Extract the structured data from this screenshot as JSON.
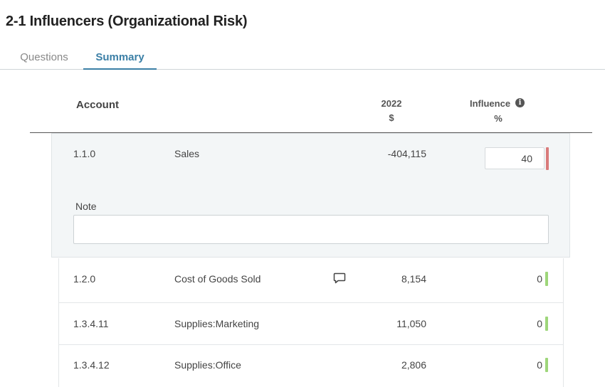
{
  "page": {
    "title": "2-1 Influencers (Organizational Risk)"
  },
  "tabs": [
    {
      "label": "Questions",
      "active": false
    },
    {
      "label": "Summary",
      "active": true
    }
  ],
  "table": {
    "headers": {
      "account": "Account",
      "year": "2022",
      "currency": "$",
      "influence": "Influence",
      "influence_unit": "%"
    },
    "expanded_row": {
      "account_number": "1.1.0",
      "account_name": "Sales",
      "amount": "-404,115",
      "influence": "40",
      "indicator_color": "#d97b7b",
      "note_label": "Note",
      "note_value": ""
    },
    "rows": [
      {
        "account_number": "1.2.0",
        "account_name": "Cost of Goods Sold",
        "amount": "8,154",
        "influence": "0",
        "has_comment": true,
        "indicator_color": "#9ed67a"
      },
      {
        "account_number": "1.3.4.11",
        "account_name": "Supplies:Marketing",
        "amount": "11,050",
        "influence": "0",
        "has_comment": false,
        "indicator_color": "#9ed67a"
      },
      {
        "account_number": "1.3.4.12",
        "account_name": "Supplies:Office",
        "amount": "2,806",
        "influence": "0",
        "has_comment": false,
        "indicator_color": "#9ed67a"
      }
    ]
  },
  "colors": {
    "accent": "#3b7fa6",
    "high_risk": "#d97b7b",
    "low_risk": "#9ed67a"
  },
  "icons": {
    "info": "info-icon",
    "comment": "comment-icon"
  }
}
